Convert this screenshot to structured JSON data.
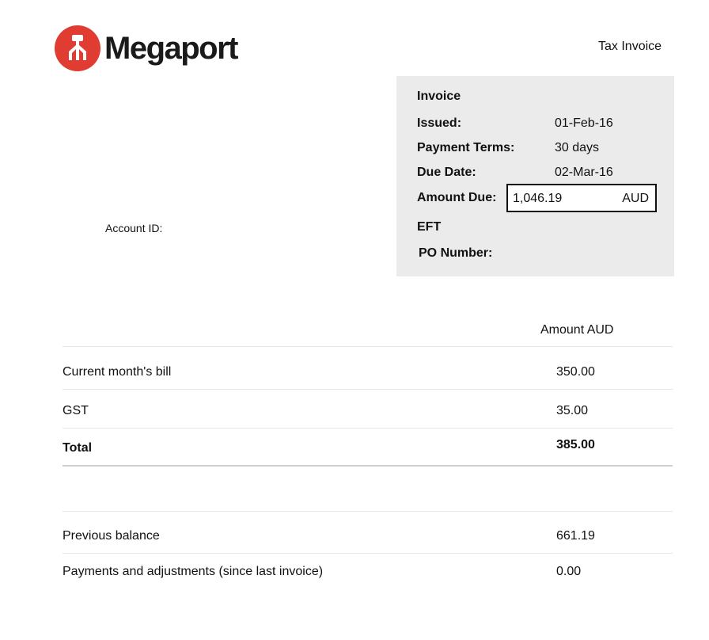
{
  "logo": {
    "text": "Megaport",
    "brand_color": "#e03c31"
  },
  "document_type": "Tax Invoice",
  "invoice_box": {
    "title": "Invoice",
    "issued_label": "Issued:",
    "issued_value": "01-Feb-16",
    "terms_label": "Payment Terms:",
    "terms_value": "30 days",
    "due_label": "Due Date:",
    "due_value": "02-Mar-16",
    "amount_due_label": "Amount Due:",
    "amount_due_value": "1,046.19",
    "amount_due_currency": "AUD",
    "payment_method": "EFT",
    "po_label": "PO Number:"
  },
  "account_id_label": "Account ID:",
  "summary": {
    "amount_header": "Amount AUD",
    "current_bill_label": "Current month's bill",
    "current_bill_value": "350.00",
    "gst_label": "GST",
    "gst_value": "35.00",
    "total_label": "Total",
    "total_value": "385.00"
  },
  "balance": {
    "previous_label": "Previous balance",
    "previous_value": "661.19",
    "payments_label": "Payments and adjustments (since last invoice)",
    "payments_value": "0.00"
  }
}
